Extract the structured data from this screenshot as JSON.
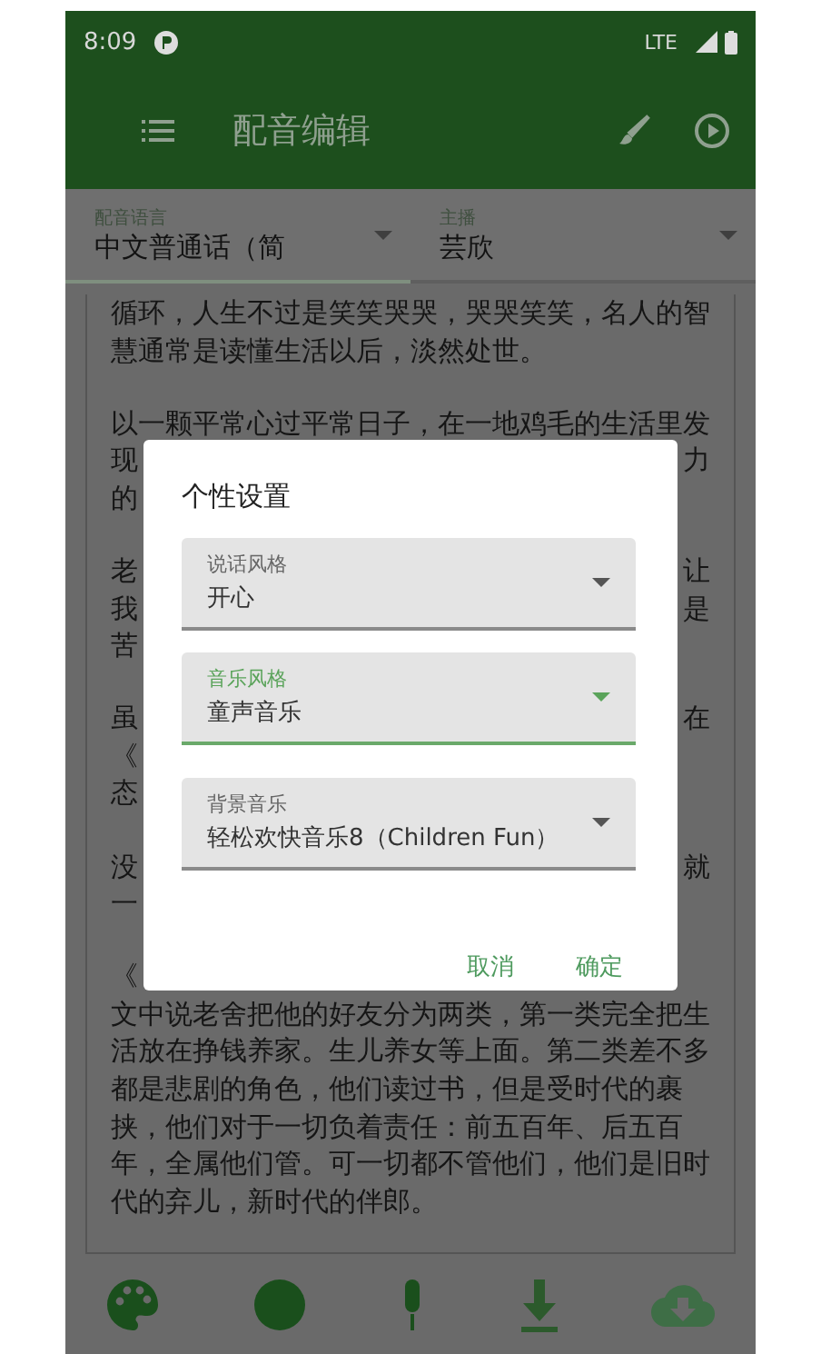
{
  "status_bar": {
    "time": "8:09",
    "network": "LTE"
  },
  "app_bar": {
    "title": "配音编辑"
  },
  "selectors": [
    {
      "label": "配音语言",
      "value": "中文普通话（简",
      "selected": true
    },
    {
      "label": "主播",
      "value": "芸欣",
      "selected": false
    }
  ],
  "paragraphs": [
    {
      "lines": [
        {
          "left": "循环，人生不过是笑笑哭哭，哭哭笑笑，名人的智"
        },
        {
          "left": "慧通常是读懂生活以后，淡然处世。"
        }
      ]
    },
    {
      "lines": [
        {
          "left": "以一颗平常心过平常日子，在一地鸡毛的生活里发"
        },
        {
          "left": "现",
          "right": "力"
        },
        {
          "left": "的"
        }
      ]
    },
    {
      "lines": [
        {
          "left": "老",
          "right": "让"
        },
        {
          "left": "我",
          "right": "是"
        },
        {
          "left": "苦"
        }
      ]
    },
    {
      "lines": [
        {
          "left": "虽",
          "right": "在"
        },
        {
          "left": "《"
        },
        {
          "left": "态"
        }
      ]
    },
    {
      "lines": [
        {
          "left": "没",
          "right": "就"
        },
        {
          "left": "一"
        }
      ]
    },
    {
      "lines": [
        {
          "left": "《"
        },
        {
          "left": "文中说老舍把他的好友分为两类，第一类完全把生"
        },
        {
          "left": "活放在挣钱养家。生儿养女等上面。第二类差不多"
        },
        {
          "left": "都是悲剧的角色，他们读过书，但是受时代的裹"
        },
        {
          "left": "挟，他们对于一切负着责任：前五百年、后五百"
        },
        {
          "left": "年，全属他们管。可一切都不管他们，他们是旧时"
        },
        {
          "left": "代的弃儿，新时代的伴郎。"
        }
      ]
    }
  ],
  "dialog": {
    "title": "个性设置",
    "fields": [
      {
        "label": "说话风格",
        "value": "开心",
        "focused": false
      },
      {
        "label": "音乐风格",
        "value": "童声音乐",
        "focused": true
      },
      {
        "label": "背景音乐",
        "value": "轻松欢快音乐8（Children Fun）",
        "focused": false
      }
    ],
    "buttons": [
      "取消",
      "确定"
    ]
  }
}
